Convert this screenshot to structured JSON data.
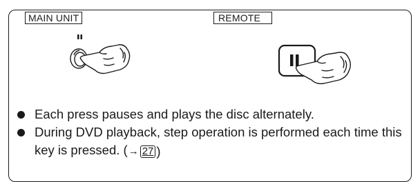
{
  "labels": {
    "main_unit": "MAIN UNIT",
    "remote": "REMOTE"
  },
  "icons": {
    "main_unit_button": "pause-button-icon",
    "remote_button": "pause-button-icon",
    "hand": "pointing-hand-icon"
  },
  "bullets": [
    {
      "text": "Each press pauses and plays the disc alternately."
    },
    {
      "text": "During DVD playback, step operation is performed each time this key is pressed. (",
      "ref_arrow": "→",
      "ref_page": "27",
      "ref_close": ")"
    }
  ]
}
